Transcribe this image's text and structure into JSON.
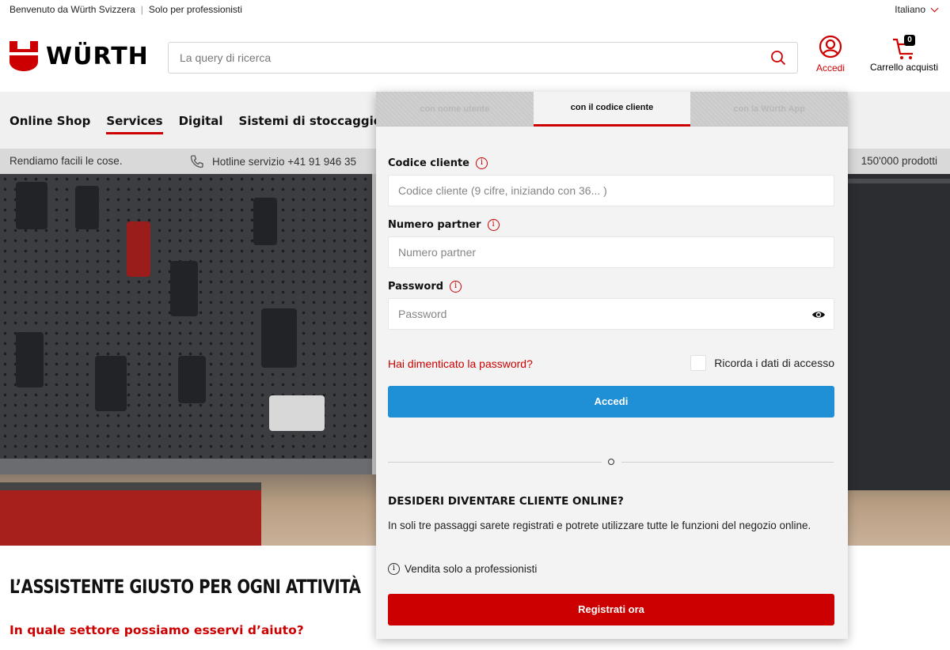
{
  "topbar": {
    "welcome": "Benvenuto da Würth Svizzera",
    "professionals": "Solo per professionisti",
    "language": "Italiano"
  },
  "header": {
    "logo_text": "WÜRTH",
    "search_placeholder": "La query di ricerca",
    "account_label": "Accedi",
    "cart_label": "Carrello acquisti",
    "cart_count": "0"
  },
  "nav": {
    "items": [
      "Online Shop",
      "Services",
      "Digital",
      "Sistemi di stoccaggio"
    ],
    "active": "Services"
  },
  "infobar": {
    "tagline": "Rendiamo facili le cose.",
    "hotline": "Hotline servizio +41 91 946 35",
    "products": "150'000 prodotti"
  },
  "login": {
    "tabs": [
      "con nome utente",
      "con il codice cliente",
      "con la Würth App"
    ],
    "active_tab": "con il codice cliente",
    "customer_code_label": "Codice cliente",
    "customer_code_placeholder": "Codice cliente (9 cifre, iniziando con 36... )",
    "partner_label": "Numero partner",
    "partner_placeholder": "Numero partner",
    "password_label": "Password",
    "password_placeholder": "Password",
    "forgot_password": "Hai dimenticato la password?",
    "remember": "Ricorda i dati di accesso",
    "login_button": "Accedi",
    "register_title": "DESIDERI DIVENTARE CLIENTE ONLINE?",
    "register_text": "In soli tre passaggi sarete registrati e potrete utilizzare tutte le funzioni del negozio online.",
    "register_note": "Vendita solo a professionisti",
    "register_button": "Registrati ora"
  },
  "content": {
    "heading": "L’ASSISTENTE GIUSTO PER OGNI ATTIVITÀ",
    "subheading": "In quale settore possiamo esservi d’aiuto?"
  },
  "colors": {
    "brand_red": "#cc0000",
    "login_blue": "#1f8fd6"
  },
  "icons": {
    "search": "search-icon",
    "account": "user-circle-icon",
    "cart": "cart-icon",
    "info": "info-icon",
    "eye": "eye-icon",
    "phone": "phone-icon",
    "language": "chevron-down-icon"
  }
}
